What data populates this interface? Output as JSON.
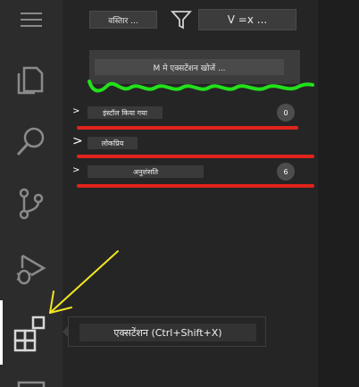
{
  "activity_bar": {
    "items": [
      {
        "icon": "hamburger-menu-icon"
      },
      {
        "icon": "explorer-files-icon"
      },
      {
        "icon": "search-icon"
      },
      {
        "icon": "source-control-icon"
      },
      {
        "icon": "run-debug-icon"
      },
      {
        "icon": "extensions-icon",
        "active": true
      },
      {
        "icon": "accounts-icon"
      }
    ]
  },
  "toolbar": {
    "details_label": "वस्तिार ...",
    "filter_icon": "filter-icon",
    "view_label": "V =x ..."
  },
  "search": {
    "button_label": "M मे एक्सटेंशन खोजें ..."
  },
  "sections": [
    {
      "label": "इंस्टॉल किया गया",
      "count": "0"
    },
    {
      "label": "लोकप्रिय",
      "count": ""
    },
    {
      "label": "अनुशंसति",
      "count": "6"
    }
  ],
  "tooltip": {
    "text": "एक्सटेंशन (Ctrl+Shift+X)"
  },
  "colors": {
    "annotation_green": "#22e01a",
    "annotation_red": "#e0241b",
    "annotation_yellow": "#f2e521",
    "activity_active_indicator": "#ffffff"
  }
}
